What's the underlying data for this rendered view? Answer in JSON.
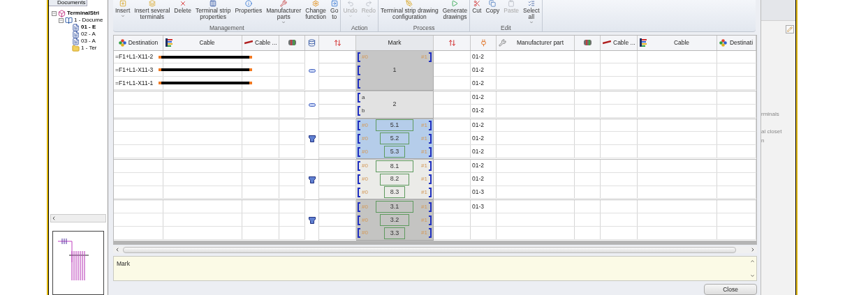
{
  "left_pane": {
    "tab": "Documents",
    "tree": [
      {
        "label": "TerminalStri",
        "kind": "project",
        "expanded": true,
        "children": [
          {
            "label": "1 - Docume",
            "kind": "book",
            "expanded": true,
            "children": [
              {
                "label": "01 - E",
                "kind": "document",
                "selected": true
              },
              {
                "label": "02 - A",
                "kind": "document",
                "selected": false
              },
              {
                "label": "03 - A",
                "kind": "document",
                "selected": false
              },
              {
                "label": "1 - Ter",
                "kind": "folder",
                "selected": false
              }
            ]
          }
        ]
      }
    ]
  },
  "ribbon": {
    "groups": [
      {
        "label": "Management",
        "buttons": [
          {
            "lines": [
              "Insert"
            ],
            "dropdown": true,
            "disabled": false
          },
          {
            "lines": [
              "Insert several",
              "terminals"
            ],
            "dropdown": false,
            "disabled": false
          },
          {
            "lines": [
              "Delete"
            ],
            "dropdown": false,
            "disabled": false
          },
          {
            "lines": [
              "Terminal strip",
              "properties"
            ],
            "dropdown": false,
            "disabled": false
          },
          {
            "lines": [
              "Properties"
            ],
            "dropdown": false,
            "disabled": false
          },
          {
            "lines": [
              "Manufacturer",
              "parts"
            ],
            "dropdown": true,
            "disabled": false
          },
          {
            "lines": [
              "Change",
              "function"
            ],
            "dropdown": false,
            "disabled": false
          },
          {
            "lines": [
              "Go",
              "to"
            ],
            "dropdown": false,
            "disabled": false
          }
        ]
      },
      {
        "label": "Action",
        "buttons": [
          {
            "lines": [
              "Undo"
            ],
            "dropdown": true,
            "disabled": true
          },
          {
            "lines": [
              "Redo"
            ],
            "dropdown": true,
            "disabled": true
          }
        ]
      },
      {
        "label": "Process",
        "buttons": [
          {
            "lines": [
              "Terminal strip drawing",
              "configuration"
            ],
            "dropdown": false,
            "disabled": false
          },
          {
            "lines": [
              "Generate",
              "drawings"
            ],
            "dropdown": false,
            "disabled": false
          }
        ]
      },
      {
        "label": "Edit",
        "buttons": [
          {
            "lines": [
              "Cut"
            ],
            "dropdown": false,
            "disabled": false
          },
          {
            "lines": [
              "Copy"
            ],
            "dropdown": false,
            "disabled": false
          },
          {
            "lines": [
              "Paste"
            ],
            "dropdown": false,
            "disabled": true
          },
          {
            "lines": [
              "Select",
              "all"
            ],
            "dropdown": true,
            "disabled": false
          }
        ]
      }
    ]
  },
  "table": {
    "columns": [
      {
        "label": "Destination"
      },
      {
        "label": "Cable"
      },
      {
        "label": "Cable ..."
      },
      {},
      {},
      {},
      {
        "label": "Mark"
      },
      {},
      {},
      {
        "label": "Manufacturer part"
      },
      {},
      {
        "label": "Cable ..."
      },
      {
        "label": "Cable"
      },
      {
        "label": "Destinati"
      }
    ],
    "groups": [
      {
        "kind": "terminal",
        "label": "1",
        "color": "#c6c6c6",
        "rows": [
          {
            "destination": "=F1+L1-X11-2",
            "wire": true,
            "left": "#0",
            "right": "#1",
            "code": "01-2"
          },
          {
            "destination": "=F1+L1-X11-3",
            "wire": true,
            "code": "01-2"
          },
          {
            "destination": "=F1+L1-X11-1",
            "wire": true,
            "code": "01-2"
          }
        ]
      },
      {
        "kind": "terminal",
        "label": "2",
        "color": "#e2e2e2",
        "rows": [
          {
            "wire": false,
            "left": "a",
            "code": "01-2"
          },
          {
            "wire": false,
            "left": "b",
            "code": "01-2"
          }
        ]
      },
      {
        "kind": "levels",
        "color": "#b5cdea",
        "rows": [
          {
            "wire": false,
            "left": "#0",
            "level": "5.1",
            "right": "#1",
            "code": "01-2"
          },
          {
            "wire": false,
            "left": "#0",
            "level": "5.2",
            "right": "#1",
            "code": "01-2"
          },
          {
            "wire": false,
            "left": "#0",
            "level": "5.3",
            "right": "#1",
            "code": "01-2"
          }
        ]
      },
      {
        "kind": "levels",
        "color": "#ebebe8",
        "rows": [
          {
            "wire": false,
            "left": "#0",
            "level": "8.1",
            "right": "#1",
            "code": "01-2"
          },
          {
            "wire": false,
            "left": "#0",
            "level": "8.2",
            "right": "#1",
            "code": "01-2"
          },
          {
            "wire": false,
            "left": "#0",
            "level": "8.3",
            "right": "#1",
            "code": "01-3"
          }
        ]
      },
      {
        "kind": "levels",
        "color": "#c4c4c2",
        "rows": [
          {
            "wire": false,
            "left": "#0",
            "level": "3.1",
            "right": "#1",
            "code": "01-3"
          },
          {
            "wire": false,
            "left": "#0",
            "level": "3.2",
            "right": "#1"
          },
          {
            "wire": false,
            "left": "#0",
            "level": "3.3",
            "right": "#1"
          }
        ]
      }
    ]
  },
  "description": {
    "value": "Mark"
  },
  "close_button": "Close",
  "right_pane": {
    "items": [
      "rminals",
      "al closet",
      "n"
    ]
  }
}
